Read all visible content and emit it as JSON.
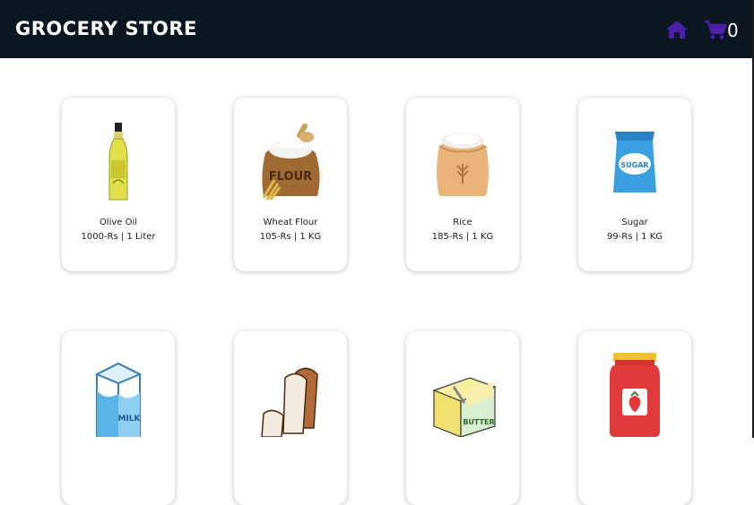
{
  "header": {
    "title": "GROCERY STORE",
    "home_icon": "home-icon",
    "cart_icon": "cart-icon",
    "cart_count": "0",
    "accent_color": "#4b1fa8",
    "background_color": "#0b1620"
  },
  "products": [
    {
      "name": "Olive Oil",
      "price": "1000-Rs | 1 Liter",
      "image": "olive-oil-bottle"
    },
    {
      "name": "Wheat Flour",
      "price": "105-Rs | 1 KG",
      "image": "flour-sack"
    },
    {
      "name": "Rice",
      "price": "185-Rs | 1 KG",
      "image": "rice-sack"
    },
    {
      "name": "Sugar",
      "price": "99-Rs | 1 KG",
      "image": "sugar-pack"
    },
    {
      "name": "",
      "price": "",
      "image": "milk-carton"
    },
    {
      "name": "",
      "price": "",
      "image": "bread-slices"
    },
    {
      "name": "",
      "price": "",
      "image": "butter-block"
    },
    {
      "name": "",
      "price": "",
      "image": "strawberry-jam-jar"
    }
  ],
  "image_labels": {
    "flour": "FLOUR",
    "sugar": "SUGAR",
    "milk": "MILK",
    "butter": "BUTTER"
  }
}
